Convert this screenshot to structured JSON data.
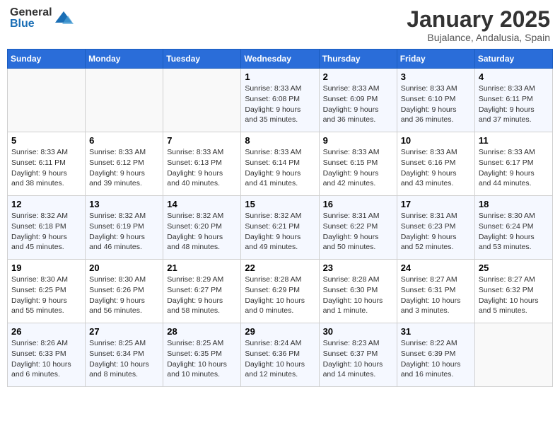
{
  "logo": {
    "general": "General",
    "blue": "Blue"
  },
  "calendar": {
    "title": "January 2025",
    "subtitle": "Bujalance, Andalusia, Spain"
  },
  "headers": [
    "Sunday",
    "Monday",
    "Tuesday",
    "Wednesday",
    "Thursday",
    "Friday",
    "Saturday"
  ],
  "weeks": [
    [
      {
        "day": "",
        "info": ""
      },
      {
        "day": "",
        "info": ""
      },
      {
        "day": "",
        "info": ""
      },
      {
        "day": "1",
        "info": "Sunrise: 8:33 AM\nSunset: 6:08 PM\nDaylight: 9 hours\nand 35 minutes."
      },
      {
        "day": "2",
        "info": "Sunrise: 8:33 AM\nSunset: 6:09 PM\nDaylight: 9 hours\nand 36 minutes."
      },
      {
        "day": "3",
        "info": "Sunrise: 8:33 AM\nSunset: 6:10 PM\nDaylight: 9 hours\nand 36 minutes."
      },
      {
        "day": "4",
        "info": "Sunrise: 8:33 AM\nSunset: 6:11 PM\nDaylight: 9 hours\nand 37 minutes."
      }
    ],
    [
      {
        "day": "5",
        "info": "Sunrise: 8:33 AM\nSunset: 6:11 PM\nDaylight: 9 hours\nand 38 minutes."
      },
      {
        "day": "6",
        "info": "Sunrise: 8:33 AM\nSunset: 6:12 PM\nDaylight: 9 hours\nand 39 minutes."
      },
      {
        "day": "7",
        "info": "Sunrise: 8:33 AM\nSunset: 6:13 PM\nDaylight: 9 hours\nand 40 minutes."
      },
      {
        "day": "8",
        "info": "Sunrise: 8:33 AM\nSunset: 6:14 PM\nDaylight: 9 hours\nand 41 minutes."
      },
      {
        "day": "9",
        "info": "Sunrise: 8:33 AM\nSunset: 6:15 PM\nDaylight: 9 hours\nand 42 minutes."
      },
      {
        "day": "10",
        "info": "Sunrise: 8:33 AM\nSunset: 6:16 PM\nDaylight: 9 hours\nand 43 minutes."
      },
      {
        "day": "11",
        "info": "Sunrise: 8:33 AM\nSunset: 6:17 PM\nDaylight: 9 hours\nand 44 minutes."
      }
    ],
    [
      {
        "day": "12",
        "info": "Sunrise: 8:32 AM\nSunset: 6:18 PM\nDaylight: 9 hours\nand 45 minutes."
      },
      {
        "day": "13",
        "info": "Sunrise: 8:32 AM\nSunset: 6:19 PM\nDaylight: 9 hours\nand 46 minutes."
      },
      {
        "day": "14",
        "info": "Sunrise: 8:32 AM\nSunset: 6:20 PM\nDaylight: 9 hours\nand 48 minutes."
      },
      {
        "day": "15",
        "info": "Sunrise: 8:32 AM\nSunset: 6:21 PM\nDaylight: 9 hours\nand 49 minutes."
      },
      {
        "day": "16",
        "info": "Sunrise: 8:31 AM\nSunset: 6:22 PM\nDaylight: 9 hours\nand 50 minutes."
      },
      {
        "day": "17",
        "info": "Sunrise: 8:31 AM\nSunset: 6:23 PM\nDaylight: 9 hours\nand 52 minutes."
      },
      {
        "day": "18",
        "info": "Sunrise: 8:30 AM\nSunset: 6:24 PM\nDaylight: 9 hours\nand 53 minutes."
      }
    ],
    [
      {
        "day": "19",
        "info": "Sunrise: 8:30 AM\nSunset: 6:25 PM\nDaylight: 9 hours\nand 55 minutes."
      },
      {
        "day": "20",
        "info": "Sunrise: 8:30 AM\nSunset: 6:26 PM\nDaylight: 9 hours\nand 56 minutes."
      },
      {
        "day": "21",
        "info": "Sunrise: 8:29 AM\nSunset: 6:27 PM\nDaylight: 9 hours\nand 58 minutes."
      },
      {
        "day": "22",
        "info": "Sunrise: 8:28 AM\nSunset: 6:29 PM\nDaylight: 10 hours\nand 0 minutes."
      },
      {
        "day": "23",
        "info": "Sunrise: 8:28 AM\nSunset: 6:30 PM\nDaylight: 10 hours\nand 1 minute."
      },
      {
        "day": "24",
        "info": "Sunrise: 8:27 AM\nSunset: 6:31 PM\nDaylight: 10 hours\nand 3 minutes."
      },
      {
        "day": "25",
        "info": "Sunrise: 8:27 AM\nSunset: 6:32 PM\nDaylight: 10 hours\nand 5 minutes."
      }
    ],
    [
      {
        "day": "26",
        "info": "Sunrise: 8:26 AM\nSunset: 6:33 PM\nDaylight: 10 hours\nand 6 minutes."
      },
      {
        "day": "27",
        "info": "Sunrise: 8:25 AM\nSunset: 6:34 PM\nDaylight: 10 hours\nand 8 minutes."
      },
      {
        "day": "28",
        "info": "Sunrise: 8:25 AM\nSunset: 6:35 PM\nDaylight: 10 hours\nand 10 minutes."
      },
      {
        "day": "29",
        "info": "Sunrise: 8:24 AM\nSunset: 6:36 PM\nDaylight: 10 hours\nand 12 minutes."
      },
      {
        "day": "30",
        "info": "Sunrise: 8:23 AM\nSunset: 6:37 PM\nDaylight: 10 hours\nand 14 minutes."
      },
      {
        "day": "31",
        "info": "Sunrise: 8:22 AM\nSunset: 6:39 PM\nDaylight: 10 hours\nand 16 minutes."
      },
      {
        "day": "",
        "info": ""
      }
    ]
  ]
}
